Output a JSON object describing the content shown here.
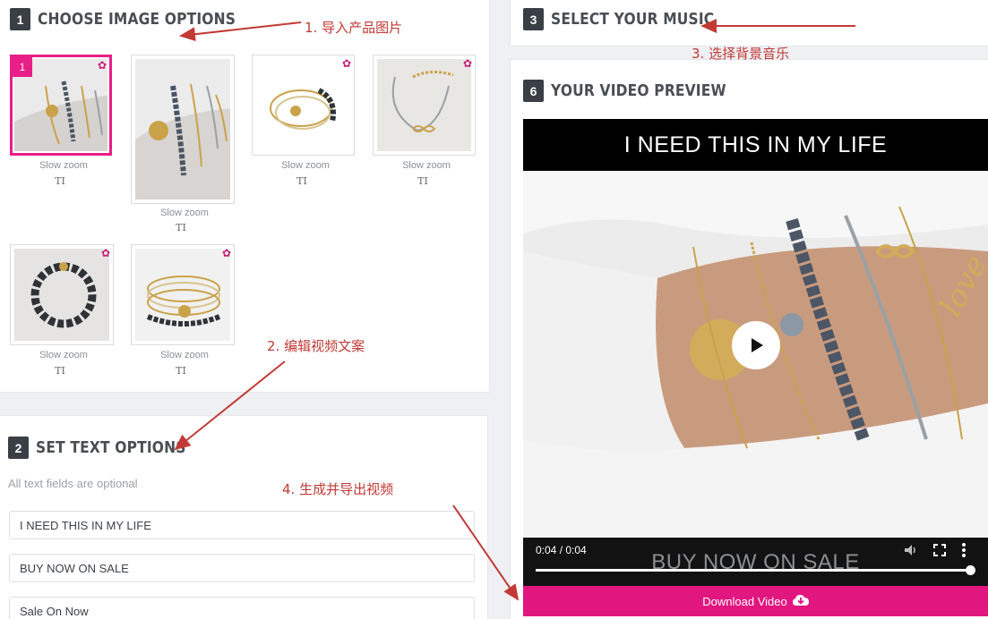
{
  "step1": {
    "number": "1",
    "title": "CHOOSE IMAGE OPTIONS"
  },
  "step2": {
    "number": "2",
    "title": "SET TEXT OPTIONS",
    "subtitle": "All text fields are optional"
  },
  "step3": {
    "number": "3",
    "title": "SELECT YOUR MUSIC"
  },
  "step6": {
    "number": "6",
    "title": "YOUR VIDEO PREVIEW"
  },
  "images": [
    {
      "badge": "1",
      "effect": "Slow zoom",
      "text_icon": "TI",
      "selected": true
    },
    {
      "effect": "Slow zoom",
      "text_icon": "TI"
    },
    {
      "effect": "Slow zoom",
      "text_icon": "TI"
    },
    {
      "effect": "Slow zoom",
      "text_icon": "TI"
    },
    {
      "effect": "Slow zoom",
      "text_icon": "TI"
    },
    {
      "effect": "Slow zoom",
      "text_icon": "TI"
    }
  ],
  "text_fields": [
    "I NEED THIS IN MY LIFE",
    "BUY NOW ON SALE",
    "Sale On Now"
  ],
  "annotations": {
    "a1": "1.  导入产品图片",
    "a2": "2.  编辑视频文案",
    "a3": "3.  选择背景音乐",
    "a4": "4.  生成并导出视频"
  },
  "video": {
    "top_caption": "I NEED THIS IN MY LIFE",
    "bottom_caption": "BUY NOW ON SALE",
    "time": "0:04 / 0:04",
    "progress": 1.0
  },
  "download_label": "Download Video",
  "colors": {
    "accent": "#e2167f",
    "annotation": "#c23a35",
    "header_badge": "#3a3f45"
  },
  "icons": [
    "gear-icon",
    "play-icon",
    "volume-icon",
    "fullscreen-icon",
    "more-icon",
    "cloud-download-icon",
    "arrow-icon"
  ]
}
